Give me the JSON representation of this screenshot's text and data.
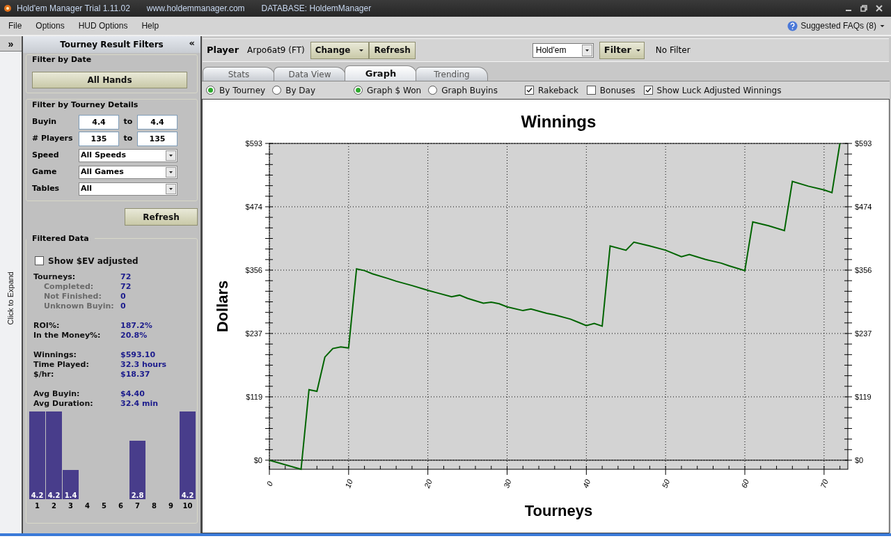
{
  "window": {
    "title": "Hold'em Manager Trial 1.11.02",
    "website": "www.holdemmanager.com",
    "database": "DATABASE: HoldemManager"
  },
  "menu": [
    "File",
    "Options",
    "HUD Options",
    "Help"
  ],
  "faq": {
    "label": "Suggested FAQs (8)"
  },
  "side_strip": {
    "expand_button": "»",
    "label": "Click to Expand"
  },
  "filters_panel": {
    "title": "Tourney Result Filters",
    "collapse_button": "«",
    "date_section": {
      "title": "Filter by Date",
      "button": "All Hands"
    },
    "details_section": {
      "title": "Filter by Tourney Details",
      "ranges": [
        {
          "label": "Buyin",
          "from": "4.4",
          "to_label": "to",
          "to": "4.4"
        },
        {
          "label": "# Players",
          "from": "135",
          "to_label": "to",
          "to": "135"
        }
      ],
      "dropdowns": [
        {
          "label": "Speed",
          "value": "All Speeds"
        },
        {
          "label": "Game",
          "value": "All Games"
        },
        {
          "label": "Tables",
          "value": "All"
        }
      ]
    },
    "refresh_button": "Refresh",
    "filtered_data": {
      "title": "Filtered Data",
      "ev_checkbox": {
        "label": "Show $EV adjusted",
        "checked": false
      },
      "stat_groups": [
        [
          {
            "label": "Tourneys:",
            "value": "72",
            "children": [
              {
                "label": "Completed:",
                "value": "72"
              },
              {
                "label": "Not Finished:",
                "value": "0"
              },
              {
                "label": "Unknown Buyin:",
                "value": "0"
              }
            ]
          }
        ],
        [
          {
            "label": "ROI%:",
            "value": "187.2%"
          },
          {
            "label": "In the Money%:",
            "value": "20.8%"
          }
        ],
        [
          {
            "label": "Winnings:",
            "value": "$593.10"
          },
          {
            "label": "Time Played:",
            "value": "32.3 hours"
          },
          {
            "label": "$/hr:",
            "value": "$18.37"
          }
        ],
        [
          {
            "label": "Avg Buyin:",
            "value": "$4.40"
          },
          {
            "label": "Avg Duration:",
            "value": "32.4 min"
          }
        ]
      ],
      "chart_data": {
        "type": "bar",
        "categories": [
          "1",
          "2",
          "3",
          "4",
          "5",
          "6",
          "7",
          "8",
          "9",
          "10"
        ],
        "values": [
          4.2,
          4.2,
          1.4,
          0,
          0,
          0,
          2.8,
          0,
          0,
          4.2
        ],
        "value_labels": [
          "4.2",
          "4.2",
          "1.4",
          null,
          null,
          null,
          "2.8",
          null,
          null,
          "4.2"
        ]
      }
    }
  },
  "player_bar": {
    "label": "Player",
    "name": "Arpo6at9 (FT)",
    "change_button": "Change",
    "refresh_button": "Refresh",
    "game_select": "Hold'em",
    "filter_button": "Filter",
    "filter_status": "No Filter"
  },
  "tabs": [
    {
      "label": "Stats",
      "selected": false
    },
    {
      "label": "Data View",
      "selected": false
    },
    {
      "label": "Graph",
      "selected": true
    },
    {
      "label": "Trending",
      "selected": false
    }
  ],
  "graph_options": {
    "radio_groups": [
      [
        {
          "label": "By Tourney",
          "selected": true
        },
        {
          "label": "By Day",
          "selected": false
        }
      ],
      [
        {
          "label": "Graph $ Won",
          "selected": true
        },
        {
          "label": "Graph Buyins",
          "selected": false
        }
      ]
    ],
    "checkboxes": [
      {
        "label": "Rakeback",
        "checked": true
      },
      {
        "label": "Bonuses",
        "checked": false
      },
      {
        "label": "Show Luck Adjusted Winnings",
        "checked": true
      }
    ]
  },
  "graph": {
    "chart_data": {
      "type": "line",
      "title": "Winnings",
      "xlabel": "Tourneys",
      "ylabel": "Dollars",
      "x": [
        0,
        4,
        5,
        6,
        7,
        8,
        9,
        10,
        11,
        12,
        13,
        15,
        16,
        18,
        20,
        21,
        23,
        24,
        25,
        27,
        28,
        29,
        30,
        32,
        33,
        35,
        36,
        38,
        39,
        40,
        41,
        42,
        43,
        45,
        46,
        48,
        50,
        52,
        53,
        55,
        57,
        58,
        60,
        61,
        63,
        65,
        66,
        68,
        70,
        71,
        72
      ],
      "values": [
        0,
        -17,
        132,
        129,
        193,
        209,
        212,
        210,
        358,
        355,
        349,
        340,
        335,
        327,
        318,
        314,
        306,
        309,
        303,
        294,
        296,
        293,
        287,
        280,
        283,
        275,
        272,
        264,
        258,
        252,
        256,
        251,
        401,
        393,
        408,
        401,
        393,
        381,
        385,
        376,
        369,
        364,
        355,
        446,
        439,
        430,
        522,
        513,
        506,
        501,
        593
      ],
      "grid": true,
      "xlim": [
        0,
        73
      ],
      "ylim": [
        -17,
        593
      ],
      "xticks": [
        0,
        10,
        20,
        30,
        40,
        50,
        60,
        70
      ],
      "yticks": [
        {
          "value": 0,
          "label": "$0"
        },
        {
          "value": 118.6,
          "label": "$119"
        },
        {
          "value": 237.2,
          "label": "$237"
        },
        {
          "value": 355.8,
          "label": "$356"
        },
        {
          "value": 474.4,
          "label": "$474"
        },
        {
          "value": 593,
          "label": "$593"
        }
      ]
    }
  }
}
